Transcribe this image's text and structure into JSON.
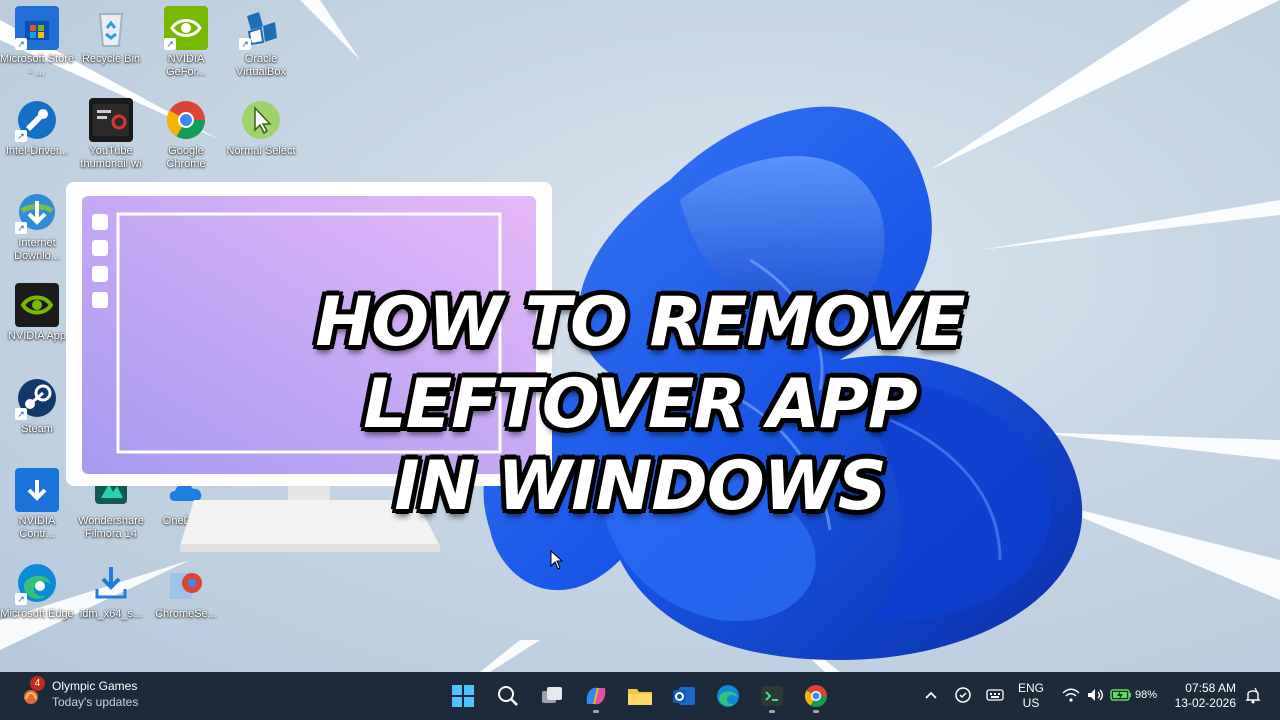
{
  "title": {
    "line1": "HOW TO REMOVE LEFTOVER APP",
    "line2": "IN WINDOWS"
  },
  "desktop_icons": {
    "store": "Microsoft Store - ...",
    "recycle": "Recycle Bin",
    "geforce": "NVIDIA GeFor...",
    "virtualbox": "Oracle VirtualBox",
    "intel": "Intel-Driver...",
    "youtube": "YouTube thumbnail wi",
    "chrome": "Google Chrome",
    "normal_select": "Normal Select",
    "idm": "Internet Downlo...",
    "nvidia_app": "NVIDIA App",
    "steam": "Steam",
    "nvidia_control": "NVIDIA Contr...",
    "filmora": "Wondershare Filmora 14",
    "onedrive": "OneDrive",
    "edge": "Microsoft Edge",
    "idm_setup": "idm_x64_s...",
    "chrome_setup": "ChromeSe..."
  },
  "taskbar": {
    "widget": {
      "badge": "4",
      "title": "Olympic Games",
      "subtitle": "Today's updates"
    },
    "apps": [
      "start-icon",
      "search-icon",
      "task-view-icon",
      "copilot-icon",
      "file-explorer-icon",
      "outlook-icon",
      "edge-icon",
      "terminal-icon",
      "chrome-icon"
    ],
    "tray": {
      "lang_top": "ENG",
      "lang_bottom": "US",
      "battery": "98%",
      "time": "07:58 AM",
      "date": "13-02-2026"
    }
  },
  "colors": {
    "taskbar": "#1d2a3a",
    "monitor_screen_start": "#a79af0",
    "monitor_screen_end": "#e5b7f8",
    "bloom_blue": "#1a57e8"
  }
}
